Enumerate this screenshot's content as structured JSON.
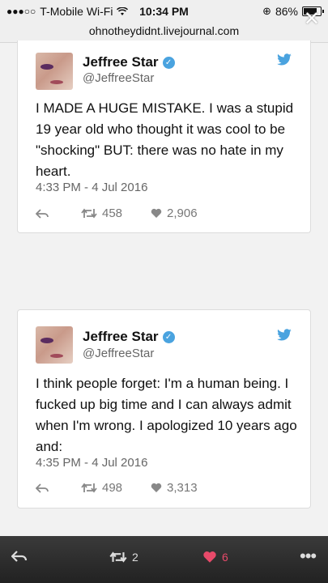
{
  "status_bar": {
    "carrier": "T-Mobile Wi-Fi",
    "time": "10:34 PM",
    "battery": "86%"
  },
  "browser": {
    "url": "ohnotheydidnt.livejournal.com"
  },
  "tweets": [
    {
      "name": "Jeffree Star",
      "handle": "@JeffreeStar",
      "text": "I MADE A HUGE MISTAKE. I was a stupid 19 year old who thought it was cool to be \"shocking\" BUT: there was no hate in my heart.",
      "time": "4:33 PM - 4 Jul 2016",
      "retweets": "458",
      "likes": "2,906"
    },
    {
      "name": "Jeffree Star",
      "handle": "@JeffreeStar",
      "text": "I think people forget: I'm a human being. I fucked up big time and I can always admit when I'm wrong. I apologized 10 years ago and:",
      "time": "4:35 PM - 4 Jul 2016",
      "retweets": "498",
      "likes": "3,313"
    }
  ],
  "bottom_bar": {
    "reblogs": "2",
    "likes": "6"
  },
  "colors": {
    "twitter_blue": "#4aa3df",
    "like_red": "#e84a6a"
  }
}
